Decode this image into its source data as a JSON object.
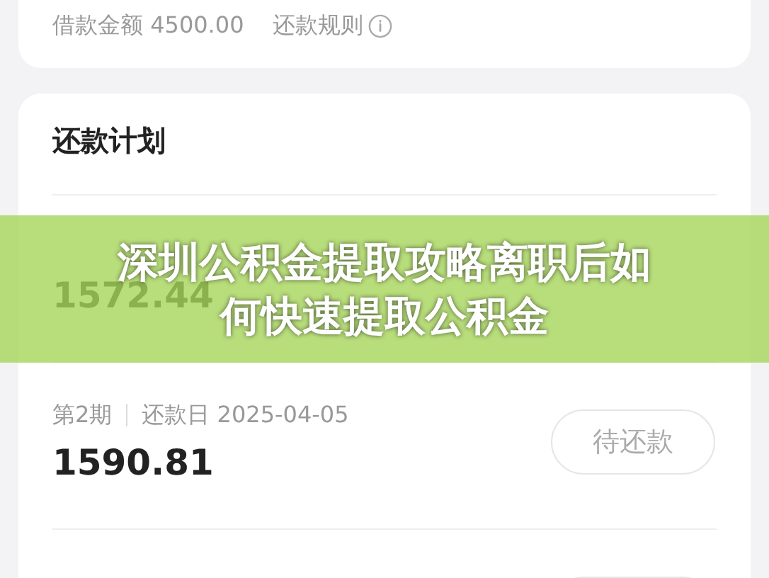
{
  "loan_card": {
    "amount_label": "借款金额 4500.00",
    "rules_link": "还款规则"
  },
  "plan": {
    "title": "还款计划",
    "rows": [
      {
        "amount": "1572.44"
      },
      {
        "period": "第2期",
        "due": "还款日 2025-04-05",
        "amount": "1590.81",
        "button": {
          "kind": "pending",
          "label": "待还款"
        }
      },
      {
        "button": {
          "kind": "pending"
        }
      }
    ]
  },
  "banner": {
    "title_lines": [
      "深圳公积金提取攻略离职后如",
      "何快速提取公积金"
    ]
  }
}
